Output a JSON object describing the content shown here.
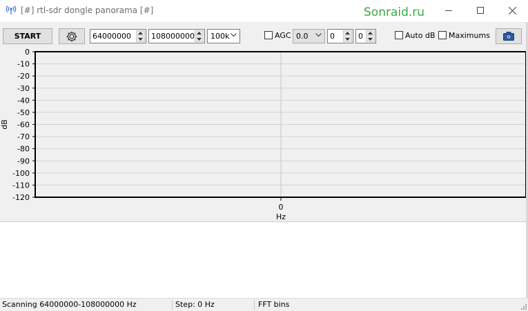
{
  "window": {
    "title": "[#] rtl-sdr dongle panorama [#]",
    "watermark": "Sonraid.ru"
  },
  "toolbar": {
    "start_label": "START",
    "freq_start": "64000000",
    "freq_end": "108000000",
    "step": "100k",
    "agc_label": "AGC",
    "agc_checked": false,
    "gain": "0.0",
    "spin1": "0",
    "spin2": "0",
    "auto_db_label": "Auto dB",
    "auto_db_checked": false,
    "maximums_label": "Maximums",
    "maximums_checked": false
  },
  "chart_data": {
    "type": "line",
    "ylabel": "dB",
    "xlabel": "Hz",
    "ylim": [
      -120,
      0
    ],
    "y_ticks": [
      "0",
      "-10",
      "-20",
      "-30",
      "-40",
      "-50",
      "-60",
      "-70",
      "-80",
      "-90",
      "-100",
      "-110",
      "-120"
    ],
    "x_ticks": [
      "0"
    ],
    "series": [],
    "grid": true
  },
  "status": {
    "scanning": "Scanning 64000000-108000000 Hz",
    "step": "Step: 0 Hz",
    "fft": "FFT bins"
  },
  "colors": {
    "watermark": "#3aa845",
    "toolbar_bg": "#f0f0f0",
    "grid": "#d3d3d3"
  }
}
